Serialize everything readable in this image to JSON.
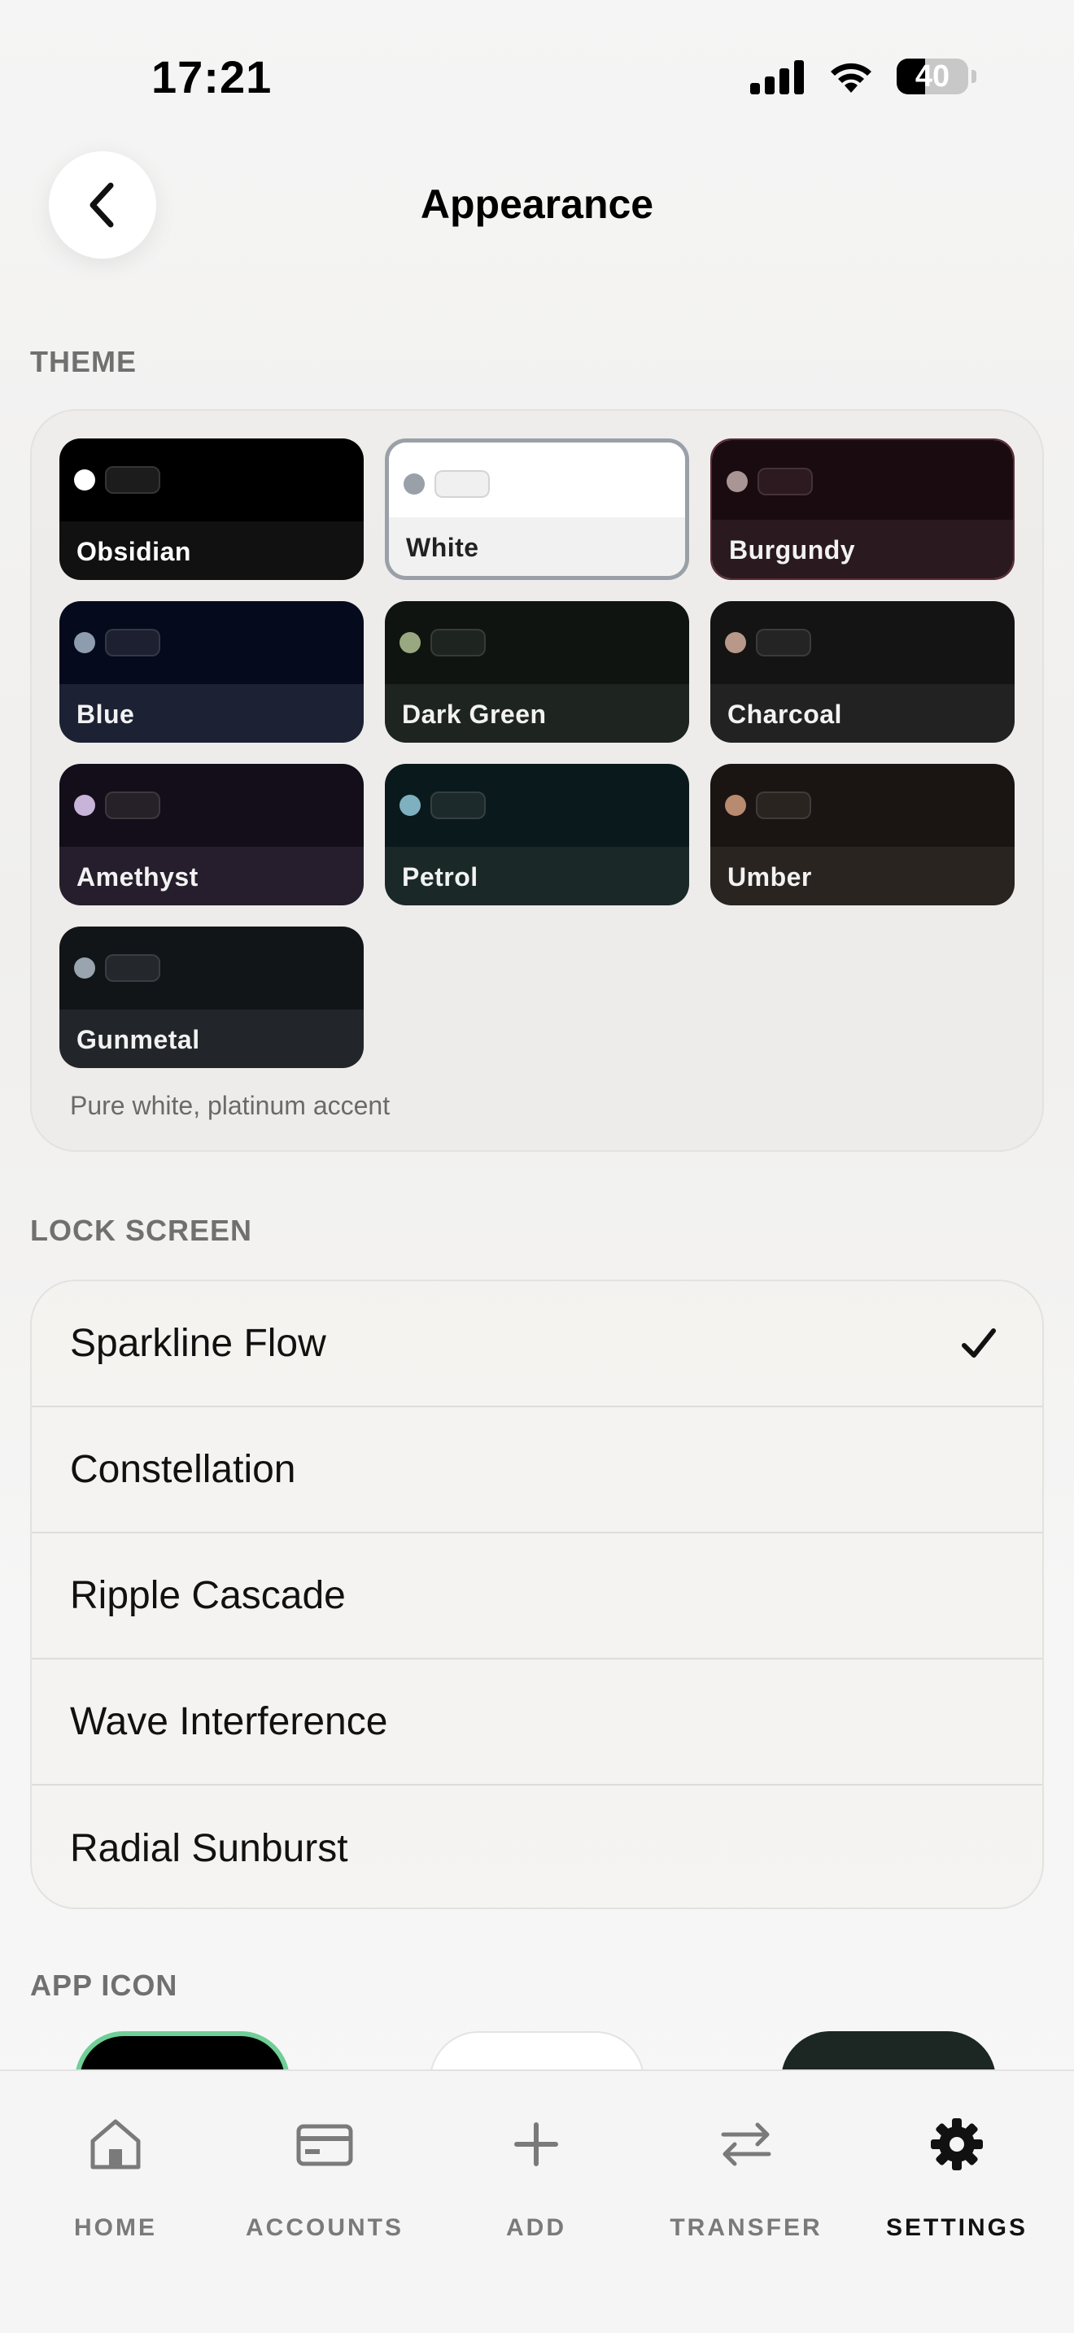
{
  "status_bar": {
    "time": "17:21",
    "battery": "40",
    "battery_level": 0.4
  },
  "header": {
    "title": "Appearance"
  },
  "theme": {
    "section_label": "THEME",
    "description": "Pure white, platinum accent",
    "selected": "White",
    "swatches": [
      {
        "name": "Obsidian",
        "top": "#000000",
        "bottom": "#111111",
        "dot": "#ffffff",
        "pill": "#1c1c1c",
        "text": "#ffffff"
      },
      {
        "name": "White",
        "top": "#ffffff",
        "bottom": "#f1f1f1",
        "dot": "#9aa0a8",
        "pill": "#f0f0f0",
        "text": "#222222"
      },
      {
        "name": "Burgundy",
        "top": "#1a0b10",
        "bottom": "#2a1a20",
        "dot": "#a89594",
        "pill": "#2c1a20",
        "text": "#f2f2f2"
      },
      {
        "name": "Blue",
        "top": "#050b1c",
        "bottom": "#1c2234",
        "dot": "#8e9cb0",
        "pill": "#1c2030",
        "text": "#f2f2f2"
      },
      {
        "name": "Dark Green",
        "top": "#0f1410",
        "bottom": "#1e2420",
        "dot": "#9aa882",
        "pill": "#1e2420",
        "text": "#f2f2f2"
      },
      {
        "name": "Charcoal",
        "top": "#141414",
        "bottom": "#222222",
        "dot": "#b89888",
        "pill": "#242424",
        "text": "#f2f2f2"
      },
      {
        "name": "Amethyst",
        "top": "#140e1a",
        "bottom": "#261e2c",
        "dot": "#c8b4d8",
        "pill": "#262028",
        "text": "#f2f2f2"
      },
      {
        "name": "Petrol",
        "top": "#0a1a1c",
        "bottom": "#1a2828",
        "dot": "#7fb0c0",
        "pill": "#1c2a2c",
        "text": "#f2f2f2"
      },
      {
        "name": "Umber",
        "top": "#1a1512",
        "bottom": "#2a2420",
        "dot": "#b88a70",
        "pill": "#2a2420",
        "text": "#f2f2f2"
      },
      {
        "name": "Gunmetal",
        "top": "#121518",
        "bottom": "#22262a",
        "dot": "#9aa4ae",
        "pill": "#24282c",
        "text": "#f2f2f2"
      }
    ]
  },
  "lock_screen": {
    "section_label": "LOCK SCREEN",
    "selected": "Sparkline Flow",
    "items": [
      {
        "label": "Sparkline Flow"
      },
      {
        "label": "Constellation"
      },
      {
        "label": "Ripple Cascade"
      },
      {
        "label": "Wave Interference"
      },
      {
        "label": "Radial Sunburst"
      }
    ]
  },
  "app_icon": {
    "section_label": "APP ICON"
  },
  "tabs": [
    {
      "label": "HOME",
      "icon": "home-icon"
    },
    {
      "label": "ACCOUNTS",
      "icon": "card-icon"
    },
    {
      "label": "ADD",
      "icon": "plus-icon"
    },
    {
      "label": "TRANSFER",
      "icon": "transfer-icon"
    },
    {
      "label": "SETTINGS",
      "icon": "gear-icon",
      "active": true
    }
  ]
}
